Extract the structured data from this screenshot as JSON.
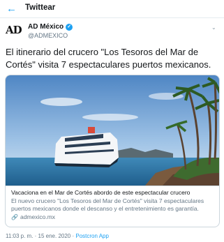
{
  "header": {
    "title": "Twittear",
    "back_icon": "arrow-left-icon"
  },
  "author": {
    "avatar_text": "AD",
    "name": "AD México",
    "handle": "@ADMEXICO",
    "verified_icon": "verified-badge-icon"
  },
  "tweet": {
    "text": "El itinerario del crucero \"Los Tesoros del Mar de Cortés\" visita 7 espectaculares puertos mexicanos."
  },
  "card": {
    "image_alt": "Cruise ship docked near palm trees",
    "title": "Vacaciona en el Mar de Cortés abordo de este espectacular crucero",
    "description": "El nuevo crucero \"Los Tesoros del Mar de Cortés\" visita 7 espectaculares puertos mexicanos donde el descanso y el entretenimiento es garantía.",
    "link": "admexico.mx",
    "link_icon": "link-icon"
  },
  "meta": {
    "timestamp": "11:03 p. m. · 15 ene. 2020 · ",
    "app": "Postcron App"
  },
  "colors": {
    "accent": "#1da1f2",
    "muted": "#657786",
    "border": "#ccd6dd"
  }
}
